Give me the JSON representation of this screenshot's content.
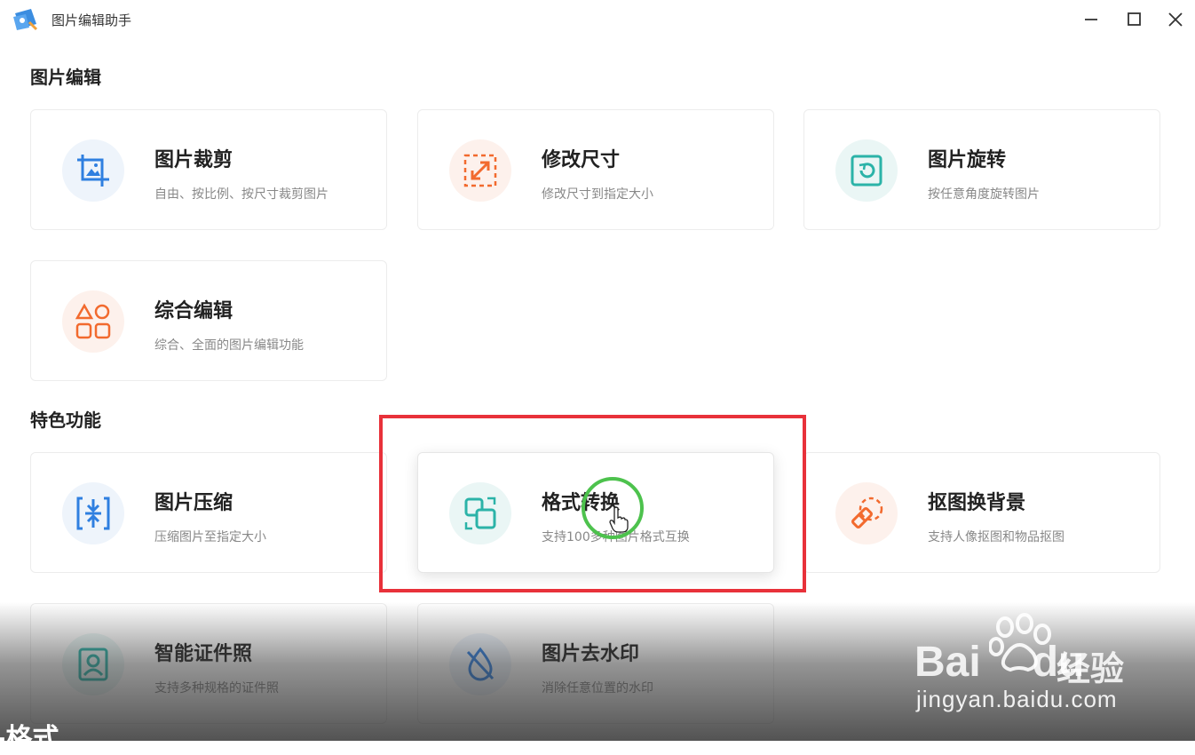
{
  "app": {
    "title": "图片编辑助手"
  },
  "sections": {
    "edit": "图片编辑",
    "feature": "特色功能"
  },
  "cards": {
    "crop": {
      "title": "图片裁剪",
      "desc": "自由、按比例、按尺寸裁剪图片"
    },
    "resize": {
      "title": "修改尺寸",
      "desc": "修改尺寸到指定大小"
    },
    "rotate": {
      "title": "图片旋转",
      "desc": "按任意角度旋转图片"
    },
    "compose": {
      "title": "综合编辑",
      "desc": "综合、全面的图片编辑功能"
    },
    "compress": {
      "title": "图片压缩",
      "desc": "压缩图片至指定大小"
    },
    "convert": {
      "title": "格式转换",
      "desc": "支持100多种图片格式互换"
    },
    "cutout": {
      "title": "抠图换背景",
      "desc": "支持人像抠图和物品抠图"
    },
    "idphoto": {
      "title": "智能证件照",
      "desc": "支持多种规格的证件照"
    },
    "dewater": {
      "title": "图片去水印",
      "desc": "消除任意位置的水印"
    }
  },
  "overlay": {
    "subtitle": "-格式",
    "watermark_brand": "Bai",
    "watermark_brand2": "du",
    "watermark_jingyan": "经验",
    "watermark_url": "jingyan.baidu.com"
  },
  "colors": {
    "blue": "#2f7fe0",
    "orange": "#f26a2e",
    "teal": "#2bb3a8",
    "highlight": "#e8313a",
    "click": "#4dc24d"
  }
}
